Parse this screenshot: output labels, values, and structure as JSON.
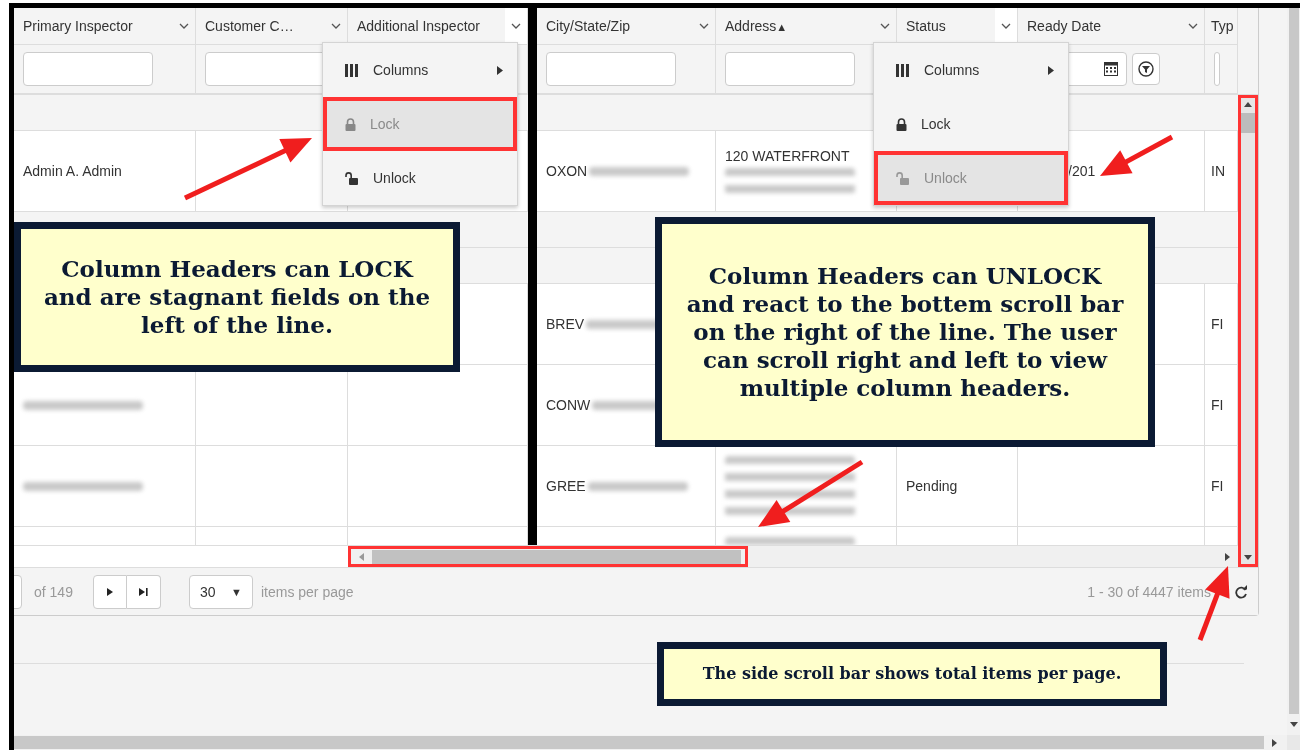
{
  "locked_columns": [
    {
      "label": "Primary Inspector",
      "caret": true,
      "filter": {
        "kind": "text"
      }
    },
    {
      "label": "Customer C…",
      "caret": true,
      "filter": {
        "kind": "text"
      }
    },
    {
      "label": "Additional Inspector",
      "caret": true,
      "menu": {
        "items": [
          {
            "kind": "columns",
            "label": "Columns",
            "disabled": false,
            "highlighted": false
          },
          {
            "kind": "lock",
            "label": "Lock",
            "disabled": true,
            "highlighted": true
          },
          {
            "kind": "unlock",
            "label": "Unlock",
            "disabled": false,
            "highlighted": false
          }
        ]
      }
    }
  ],
  "columns": [
    {
      "label": "City/State/Zip",
      "caret": true,
      "filter": {
        "kind": "text"
      }
    },
    {
      "label": "Address",
      "sort_indicator": "▲",
      "caret": true,
      "filter": {
        "kind": "text"
      }
    },
    {
      "label": "Status",
      "caret": true,
      "menu": {
        "items": [
          {
            "kind": "columns",
            "label": "Columns",
            "disabled": false,
            "highlighted": false
          },
          {
            "kind": "lock",
            "label": "Lock",
            "disabled": false,
            "highlighted": false
          },
          {
            "kind": "unlock",
            "label": "Unlock",
            "disabled": true,
            "highlighted": true
          }
        ]
      }
    },
    {
      "label": "Ready Date",
      "caret": true,
      "filter": {
        "kind": "date"
      }
    },
    {
      "label": "Typ",
      "caret": false,
      "filter": {
        "kind": "text"
      }
    }
  ],
  "rows": [
    {
      "kind": "group"
    },
    {
      "kind": "record",
      "locked_cells": [
        {
          "text": "Admin A. Admin",
          "blurred": false
        },
        {
          "blurred": false
        },
        {}
      ],
      "cells": [
        {
          "text": "OXON",
          "blurred": true
        },
        {
          "text": "120 WATERFRONT",
          "blurred": true
        },
        {},
        {
          "text": "/201",
          "blurred": false
        },
        {
          "text": "IN",
          "blurred": false
        }
      ]
    },
    {
      "kind": "group"
    },
    {
      "kind": "group"
    },
    {
      "kind": "record",
      "locked_cells": [
        {},
        {},
        {}
      ],
      "cells": [
        {
          "text": "BREV",
          "blurred": true
        },
        {},
        {},
        {},
        {
          "text": "FI",
          "blurred": false
        }
      ]
    },
    {
      "kind": "record",
      "locked_cells": [
        {
          "blurred": true
        },
        {
          "blurred": false
        },
        {
          "blurred": false
        }
      ],
      "cells": [
        {
          "text": "CONW",
          "blurred": true
        },
        {},
        {},
        {},
        {
          "text": "FI",
          "blurred": false
        }
      ]
    },
    {
      "kind": "record",
      "locked_cells": [
        {
          "blurred": true
        },
        {
          "blurred": false
        },
        {
          "blurred": false
        }
      ],
      "cells": [
        {
          "text": "GREE",
          "blurred": true
        },
        {
          "blurred": true
        },
        {
          "text": "Pending",
          "blurred": false
        },
        {
          "blurred": false
        },
        {
          "text": "FI",
          "blurred": false
        }
      ]
    },
    {
      "kind": "record",
      "locked_cells": [
        {},
        {},
        {}
      ],
      "cells": [
        {},
        {
          "blurred": true
        },
        {},
        {},
        {}
      ]
    }
  ],
  "h_scrollbar": {
    "highlighted": true
  },
  "v_scrollbar": {
    "highlighted": true
  },
  "pager": {
    "page_of": "of 149",
    "page_size": "30",
    "page_size_caret": "▼",
    "page_size_label": "items per page",
    "summary": "1 - 30 of 4447 items"
  },
  "callouts": [
    {
      "text": "Column Headers can LOCK and are stagnant fields on the left of the line."
    },
    {
      "text": "Column Headers can UNLOCK and react to the bottem scroll bar on the right of the line. The user can scroll right and left to view multiple column headers."
    },
    {
      "text": "The side scroll bar shows total items per page."
    }
  ]
}
